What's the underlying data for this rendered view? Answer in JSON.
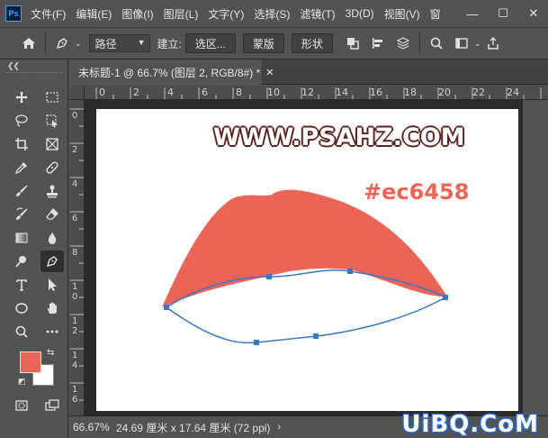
{
  "app": {
    "logo": "Ps"
  },
  "menu": [
    "文件(F)",
    "编辑(E)",
    "图像(I)",
    "图层(L)",
    "文字(Y)",
    "选择(S)",
    "滤镜(T)",
    "3D(D)",
    "视图(V)",
    "窗"
  ],
  "window_controls": {
    "minimize": "—",
    "maximize": "☐",
    "close": "✕"
  },
  "options": {
    "mode_select": "路径",
    "build_label": "建立:",
    "btn_selection": "选区...",
    "btn_mask": "蒙版",
    "btn_shape": "形状"
  },
  "document": {
    "tab_title": "未标题-1 @ 66.7% (图层 2, RGB/8#) *",
    "close": "✕"
  },
  "ruler_top": [
    "0",
    "2",
    "4",
    "6",
    "8",
    "10",
    "12",
    "14",
    "16",
    "18",
    "20",
    "22",
    "24"
  ],
  "ruler_left": [
    "0",
    "2",
    "4",
    "6",
    "8",
    "1 0",
    "1 2",
    "1 4",
    "1 6"
  ],
  "canvas": {
    "site_title": "WWW.PSAHZ.COM",
    "hex_label": "#ec6458",
    "lip_color": "#ec6458",
    "path_color": "#3a78c2"
  },
  "colors": {
    "foreground": "#ec6458",
    "background": "#ffffff"
  },
  "status": {
    "zoom": "66.67%",
    "info": "24.69 厘米 x 17.64 厘米 (72 ppi)",
    "arrow": "›"
  },
  "watermark": "UiBQ.CoM",
  "icons": {
    "tools": [
      "move-icon",
      "marquee-icon",
      "lasso-icon",
      "object-select-icon",
      "crop-icon",
      "frame-icon",
      "eyedropper-icon",
      "healing-icon",
      "brush-icon",
      "stamp-icon",
      "history-brush-icon",
      "eraser-icon",
      "gradient-icon",
      "blur-icon",
      "dodge-icon",
      "pen-icon",
      "type-icon",
      "path-select-icon",
      "ellipse-icon",
      "hand-icon",
      "zoom-icon",
      "more-icon",
      "quickmask-icon",
      "screen-mode-icon"
    ]
  }
}
